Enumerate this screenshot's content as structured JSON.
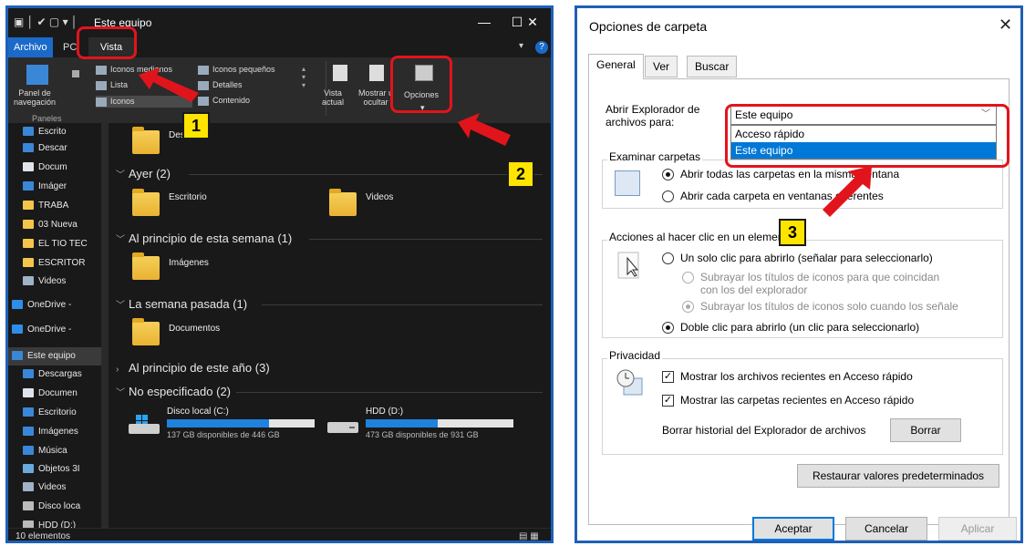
{
  "explorer": {
    "title": "Este equipo",
    "tabs": [
      "Archivo",
      "PC",
      "Vista"
    ],
    "ribbon": {
      "nav_pane": "Panel de\nnavegación",
      "layouts": [
        "Iconos medianos",
        "Iconos pequeños",
        "Lista",
        "Detalles",
        "Iconos",
        "Contenido"
      ],
      "current_view": "Vista\nactual",
      "show_hide": "Mostrar u\nocultar",
      "options": "Opciones",
      "group_label": "Paneles"
    },
    "sidebar": [
      "Escrito",
      "Descar",
      "Docum",
      "Imáger",
      "TRABA",
      "03 Nueva",
      "EL TIO TEC",
      "ESCRITOR",
      "Videos",
      "OneDrive -",
      "OneDrive -",
      "Este equipo",
      "Descargas",
      "Documen",
      "Escritorio",
      "Imágenes",
      "Música",
      "Objetos 3I",
      "Videos",
      "Disco loca",
      "HDD (D:)"
    ],
    "groups": {
      "ayer": "Ayer (2)",
      "semana": "Al principio de esta semana (1)",
      "pasada": "La semana pasada (1)",
      "anio": "Al principio de este año (3)",
      "noesp": "No especificado (2)"
    },
    "items": {
      "top": "Desc",
      "escritorio": "Escritorio",
      "videos": "Videos",
      "imagenes": "Imágenes",
      "documentos": "Documentos"
    },
    "drives": [
      {
        "name": "Disco local (C:)",
        "free": "137 GB disponibles de 446 GB",
        "used_fraction": 0.69
      },
      {
        "name": "HDD (D:)",
        "free": "473 GB disponibles de 931 GB",
        "used_fraction": 0.49
      }
    ],
    "status": "10 elementos"
  },
  "badges": [
    "1",
    "2",
    "3"
  ],
  "dialog": {
    "title": "Opciones de carpeta",
    "tabs": [
      "General",
      "Ver",
      "Buscar"
    ],
    "open_label": "Abrir Explorador de\narchivos para:",
    "combo_value": "Este equipo",
    "combo_options": [
      "Acceso rápido",
      "Este equipo"
    ],
    "browse": {
      "legend": "Examinar carpetas",
      "opt1": "Abrir todas las carpetas en la misma ventana",
      "opt2": "Abrir cada carpeta en ventanas diferentes"
    },
    "click": {
      "legend": "Acciones al hacer clic en un elemento",
      "single": "Un solo clic para abrirlo (señalar para seleccionarlo)",
      "sub1": "Subrayar los títulos de iconos para que coincidan\ncon los del explorador",
      "sub2": "Subrayar los títulos de iconos solo cuando los señale",
      "double": "Doble clic para abrirlo (un clic para seleccionarlo)"
    },
    "privacy": {
      "legend": "Privacidad",
      "chk1": "Mostrar los archivos recientes en Acceso rápido",
      "chk2": "Mostrar las carpetas recientes en Acceso rápido",
      "clear_label": "Borrar historial del Explorador de archivos",
      "clear_btn": "Borrar"
    },
    "restore": "Restaurar valores predeterminados",
    "buttons": [
      "Aceptar",
      "Cancelar",
      "Aplicar"
    ]
  }
}
